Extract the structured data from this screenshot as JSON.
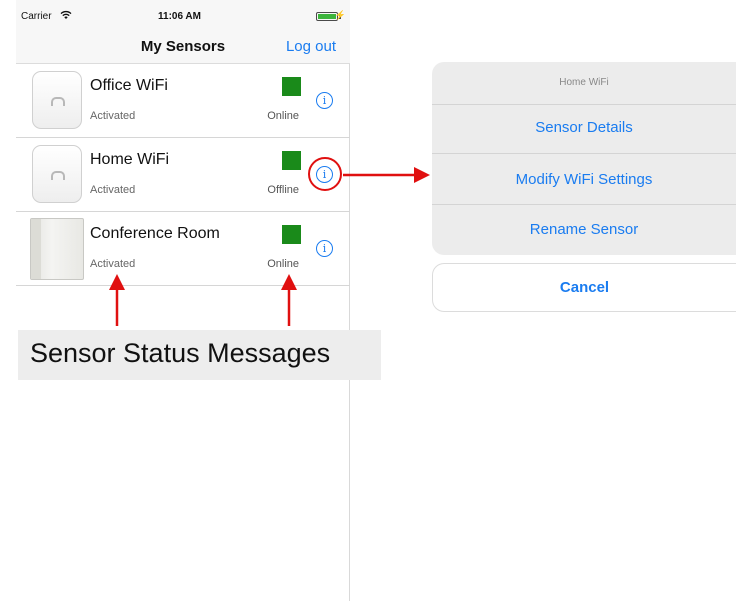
{
  "status_bar": {
    "carrier": "Carrier",
    "wifi_icon": "wifi-icon",
    "time": "11:06 AM"
  },
  "nav": {
    "title": "My Sensors",
    "logout": "Log out"
  },
  "sensors": [
    {
      "name": "Office WiFi",
      "activation": "Activated",
      "connection": "Online",
      "status_color": "#1a8a1a"
    },
    {
      "name": "Home WiFi",
      "activation": "Activated",
      "connection": "Offline",
      "status_color": "#1a8a1a"
    },
    {
      "name": "Conference Room",
      "activation": "Activated",
      "connection": "Online",
      "status_color": "#1a8a1a"
    }
  ],
  "annotation": {
    "label": "Sensor Status Messages",
    "color": "#e01010"
  },
  "action_sheet": {
    "title": "Home WiFi",
    "actions": [
      "Sensor Details",
      "Modify WiFi Settings",
      "Rename Sensor"
    ],
    "cancel": "Cancel"
  },
  "colors": {
    "accent": "#1a7cf0",
    "status": "#1a8a1a",
    "annotation": "#e01010"
  }
}
